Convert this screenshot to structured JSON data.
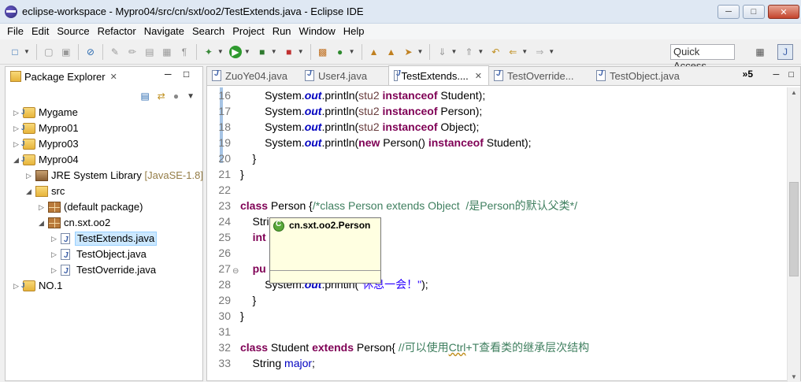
{
  "window": {
    "title": "eclipse-workspace - Mypro04/src/cn/sxt/oo2/TestExtends.java - Eclipse IDE"
  },
  "menu": [
    "File",
    "Edit",
    "Source",
    "Refactor",
    "Navigate",
    "Search",
    "Project",
    "Run",
    "Window",
    "Help"
  ],
  "toolbar": {
    "quick_access": "Quick Access"
  },
  "package_explorer": {
    "tab_label": "Package Explorer",
    "items": [
      {
        "label": "Mygame"
      },
      {
        "label": "Mypro01"
      },
      {
        "label": "Mypro03"
      },
      {
        "label": "Mypro04"
      },
      {
        "label": "JRE System Library",
        "decoration": "[JavaSE-1.8]"
      },
      {
        "label": "src"
      },
      {
        "label": "(default package)"
      },
      {
        "label": "cn.sxt.oo2"
      },
      {
        "label": "TestExtends.java"
      },
      {
        "label": "TestObject.java"
      },
      {
        "label": "TestOverride.java"
      },
      {
        "label": "NO.1"
      }
    ]
  },
  "editor": {
    "tabs": [
      "ZuoYe04.java",
      "User4.java",
      "TestExtends....",
      "TestOverride...",
      "TestObject.java"
    ],
    "more_tabs": "»5",
    "line_numbers": [
      "16",
      "17",
      "18",
      "19",
      "20",
      "21",
      "22",
      "23",
      "24",
      "25",
      "26",
      "27",
      "28",
      "29",
      "30",
      "31",
      "32",
      "33"
    ]
  },
  "popup": {
    "text": "cn.sxt.oo2.Person"
  }
}
